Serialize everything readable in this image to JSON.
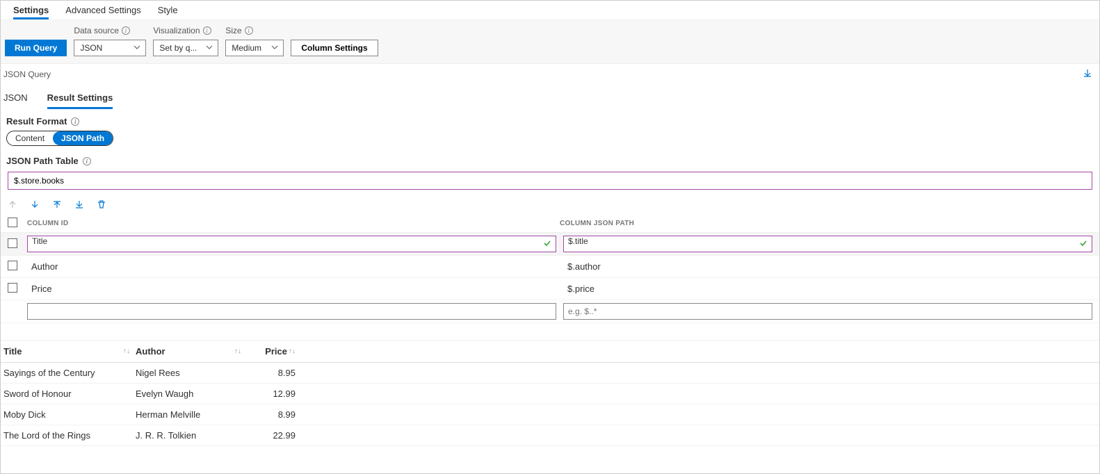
{
  "tabs_top": {
    "settings": "Settings",
    "advanced": "Advanced Settings",
    "style": "Style"
  },
  "toolbar": {
    "run_query": "Run Query",
    "data_source_label": "Data source",
    "data_source_value": "JSON",
    "visualization_label": "Visualization",
    "visualization_value": "Set by q...",
    "size_label": "Size",
    "size_value": "Medium",
    "column_settings": "Column Settings"
  },
  "json_query_label": "JSON Query",
  "tabs_sub": {
    "json": "JSON",
    "result_settings": "Result Settings"
  },
  "result_format_label": "Result Format",
  "pills": {
    "content": "Content",
    "json_path": "JSON Path"
  },
  "json_path_table_label": "JSON Path Table",
  "json_path_table_value": "$.store.books",
  "columns_header": {
    "id": "COLUMN ID",
    "path": "COLUMN JSON PATH"
  },
  "columns": [
    {
      "id": "Title",
      "path": "$.title",
      "selected": true,
      "validated": true
    },
    {
      "id": "Author",
      "path": "$.author",
      "selected": false,
      "validated": false
    },
    {
      "id": "Price",
      "path": "$.price",
      "selected": false,
      "validated": false
    }
  ],
  "new_column_placeholder": "e.g. $..*",
  "result_headers": {
    "title": "Title",
    "author": "Author",
    "price": "Price"
  },
  "result_rows": [
    {
      "title": "Sayings of the Century",
      "author": "Nigel Rees",
      "price": "8.95"
    },
    {
      "title": "Sword of Honour",
      "author": "Evelyn Waugh",
      "price": "12.99"
    },
    {
      "title": "Moby Dick",
      "author": "Herman Melville",
      "price": "8.99"
    },
    {
      "title": "The Lord of the Rings",
      "author": "J. R. R. Tolkien",
      "price": "22.99"
    }
  ]
}
